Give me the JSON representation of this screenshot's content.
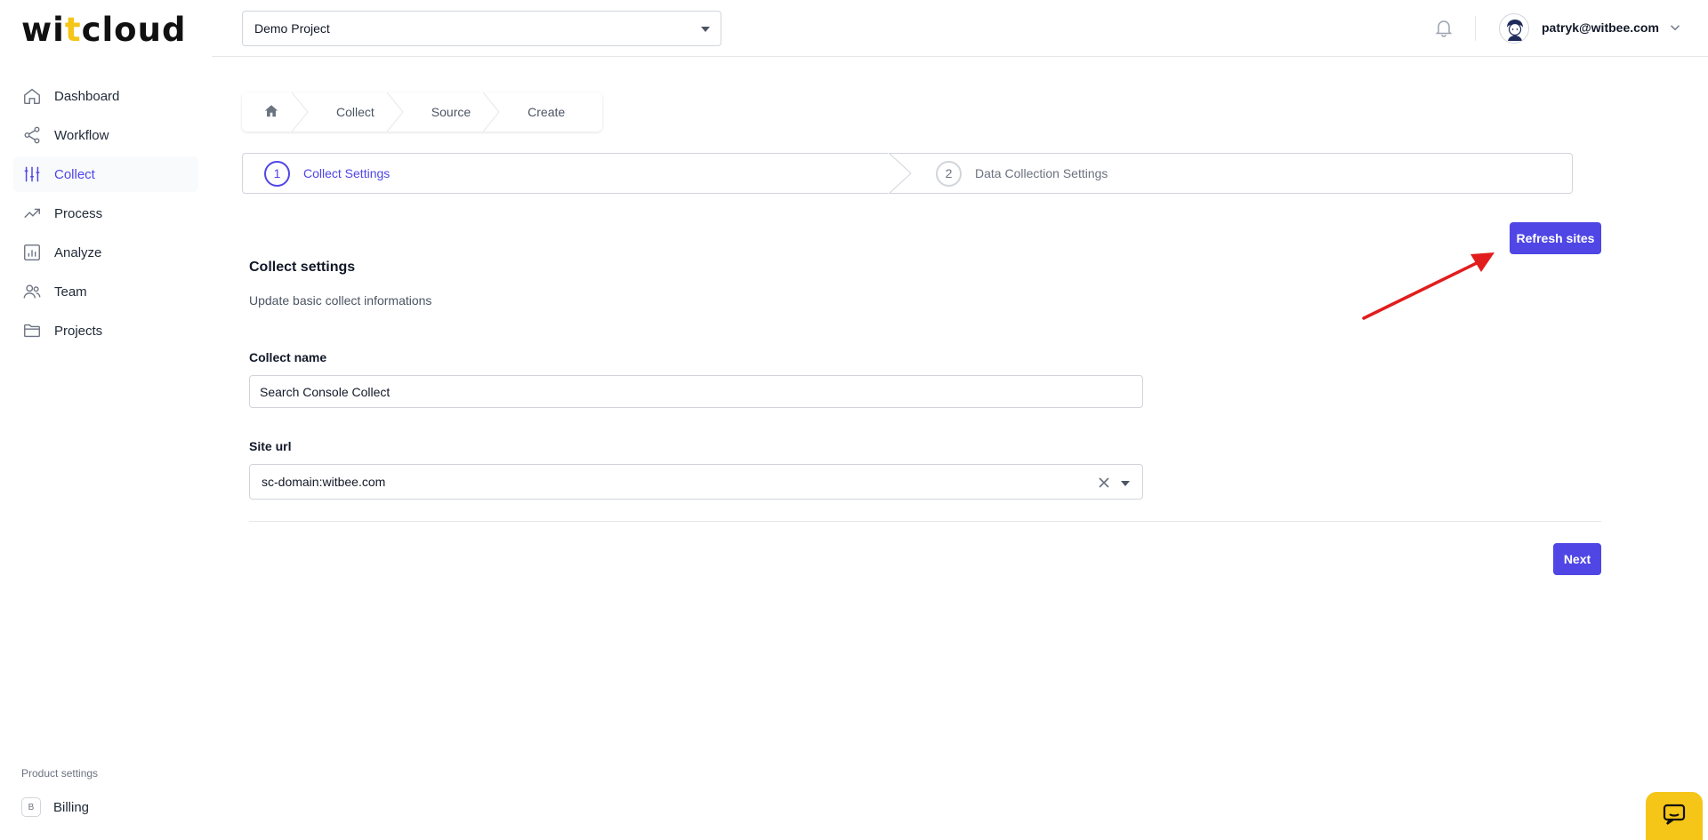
{
  "logo": {
    "before": "wi",
    "accent": "t",
    "after": "cloud"
  },
  "sidebar": {
    "items": [
      {
        "label": "Dashboard",
        "icon": "home-icon"
      },
      {
        "label": "Workflow",
        "icon": "share-icon"
      },
      {
        "label": "Collect",
        "icon": "sliders-icon",
        "active": true
      },
      {
        "label": "Process",
        "icon": "trending-up-icon"
      },
      {
        "label": "Analyze",
        "icon": "bar-chart-icon"
      },
      {
        "label": "Team",
        "icon": "users-icon"
      },
      {
        "label": "Projects",
        "icon": "folder-icon"
      }
    ],
    "product_settings_label": "Product settings",
    "billing": {
      "badge": "B",
      "label": "Billing"
    }
  },
  "topbar": {
    "project_select": "Demo Project",
    "user_email": "patryk@witbee.com"
  },
  "breadcrumb": [
    "Collect",
    "Source",
    "Create"
  ],
  "steps": [
    {
      "number": "1",
      "label": "Collect Settings",
      "state": "active"
    },
    {
      "number": "2",
      "label": "Data Collection Settings",
      "state": "inactive"
    }
  ],
  "buttons": {
    "refresh_sites": "Refresh sites",
    "next": "Next"
  },
  "form": {
    "title": "Collect settings",
    "subtitle": "Update basic collect informations",
    "collect_name_label": "Collect name",
    "collect_name_value": "Search Console Collect",
    "site_url_label": "Site url",
    "site_url_value": "sc-domain:witbee.com"
  },
  "colors": {
    "accent": "#4f46e5",
    "brand_yellow": "#f5c518",
    "annotation_red": "#e11d1d"
  }
}
